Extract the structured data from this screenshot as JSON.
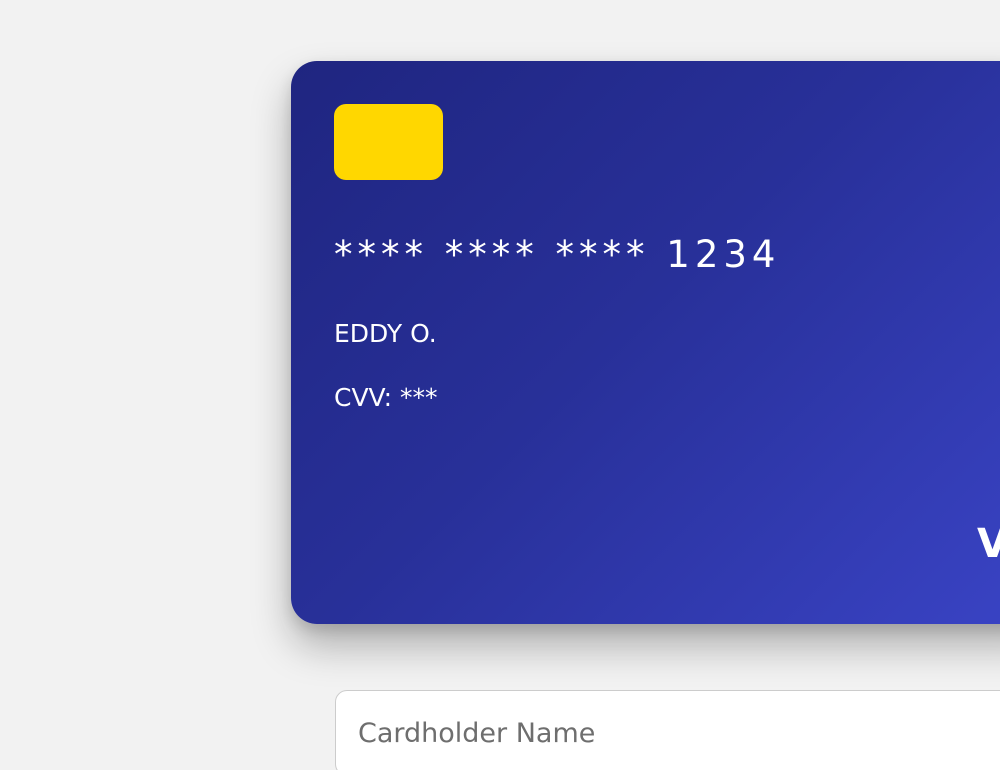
{
  "card": {
    "number": "**** **** **** 1234",
    "holder": "EDDY O.",
    "cvv": "CVV: ***",
    "brand": "VISA",
    "chip_color": "#ffd700",
    "gradient_start": "#1f2580",
    "gradient_end": "#3a44c6"
  },
  "form": {
    "cardholder_placeholder": "Cardholder Name",
    "cardholder_value": ""
  }
}
